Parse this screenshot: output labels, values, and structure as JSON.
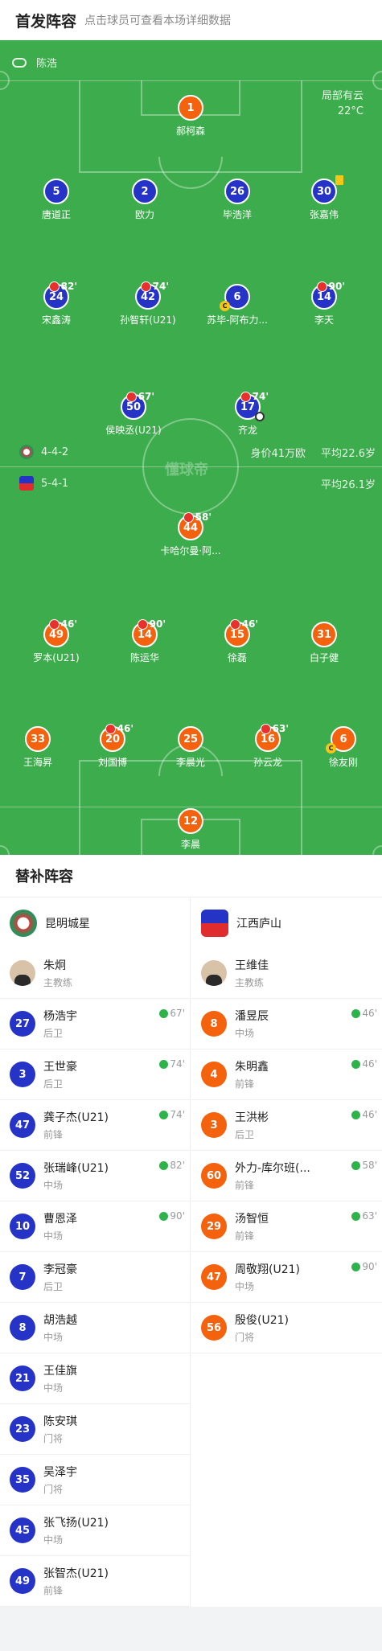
{
  "header": {
    "title": "首发阵容",
    "subtitle": "点击球员可查看本场详细数据"
  },
  "referee": "陈浩",
  "weather": {
    "condition": "局部有云",
    "temp": "22°C"
  },
  "watermark": "懂球帝",
  "home": {
    "formation": "4-4-2",
    "value": "身价41万欧",
    "avg_age": "平均22.6岁",
    "color": "#2533c6"
  },
  "away": {
    "formation": "5-4-1",
    "avg_age": "平均26.1岁",
    "color": "#f5620e"
  },
  "home_players": [
    {
      "num": "1",
      "name": "郝柯森",
      "team": "orange"
    },
    {
      "num": "5",
      "name": "唐道正"
    },
    {
      "num": "2",
      "name": "欧力"
    },
    {
      "num": "26",
      "name": "毕浩洋"
    },
    {
      "num": "30",
      "name": "张嘉伟",
      "yellow": true
    },
    {
      "num": "24",
      "name": "宋鑫涛",
      "sub": "82'"
    },
    {
      "num": "42",
      "name": "孙智轩(U21)",
      "sub": "74'"
    },
    {
      "num": "6",
      "name": "苏毕-阿布力...",
      "captain": true
    },
    {
      "num": "14",
      "name": "李天",
      "sub": "90'"
    },
    {
      "num": "50",
      "name": "侯映丞(U21)",
      "sub": "67'"
    },
    {
      "num": "17",
      "name": "齐龙",
      "sub": "74'",
      "goal": true
    }
  ],
  "away_players": [
    {
      "num": "44",
      "name": "卡哈尔曼·阿...",
      "sub": "58'"
    },
    {
      "num": "49",
      "name": "罗本(U21)",
      "sub": "46'"
    },
    {
      "num": "14",
      "name": "陈运华",
      "sub": "90'"
    },
    {
      "num": "15",
      "name": "徐磊",
      "sub": "46'"
    },
    {
      "num": "31",
      "name": "白子健"
    },
    {
      "num": "33",
      "name": "王海昇"
    },
    {
      "num": "20",
      "name": "刘国博",
      "sub": "46'"
    },
    {
      "num": "25",
      "name": "李晨光"
    },
    {
      "num": "16",
      "name": "孙云龙",
      "sub": "63'"
    },
    {
      "num": "6",
      "name": "徐友刚",
      "captain": true
    },
    {
      "num": "12",
      "name": "李晨"
    }
  ],
  "bench": {
    "title": "替补阵容",
    "home_team": "昆明城星",
    "away_team": "江西庐山",
    "home_coach": {
      "name": "朱炯",
      "role": "主教练"
    },
    "away_coach": {
      "name": "王维佳",
      "role": "主教练"
    },
    "home_subs": [
      {
        "num": "27",
        "name": "杨浩宇",
        "pos": "后卫",
        "in": "67'"
      },
      {
        "num": "3",
        "name": "王世豪",
        "pos": "后卫",
        "in": "74'"
      },
      {
        "num": "47",
        "name": "龚子杰(U21)",
        "pos": "前锋",
        "in": "74'"
      },
      {
        "num": "52",
        "name": "张瑞峰(U21)",
        "pos": "中场",
        "in": "82'"
      },
      {
        "num": "10",
        "name": "曹恩泽",
        "pos": "中场",
        "in": "90'"
      },
      {
        "num": "7",
        "name": "李冠豪",
        "pos": "后卫"
      },
      {
        "num": "8",
        "name": "胡浩越",
        "pos": "中场"
      },
      {
        "num": "21",
        "name": "王佳旗",
        "pos": "中场"
      },
      {
        "num": "23",
        "name": "陈安琪",
        "pos": "门将"
      },
      {
        "num": "35",
        "name": "吴泽宇",
        "pos": "门将"
      },
      {
        "num": "45",
        "name": "张飞扬(U21)",
        "pos": "中场"
      },
      {
        "num": "49",
        "name": "张智杰(U21)",
        "pos": "前锋"
      }
    ],
    "away_subs": [
      {
        "num": "8",
        "name": "潘昱辰",
        "pos": "中场",
        "in": "46'"
      },
      {
        "num": "4",
        "name": "朱明鑫",
        "pos": "前锋",
        "in": "46'"
      },
      {
        "num": "3",
        "name": "王洪彬",
        "pos": "后卫",
        "in": "46'"
      },
      {
        "num": "60",
        "name": "外力-库尔班(...",
        "pos": "前锋",
        "in": "58'"
      },
      {
        "num": "29",
        "name": "汤智恒",
        "pos": "前锋",
        "in": "63'"
      },
      {
        "num": "47",
        "name": "周敬翔(U21)",
        "pos": "中场",
        "in": "90'"
      },
      {
        "num": "56",
        "name": "殷俊(U21)",
        "pos": "门将"
      }
    ]
  }
}
